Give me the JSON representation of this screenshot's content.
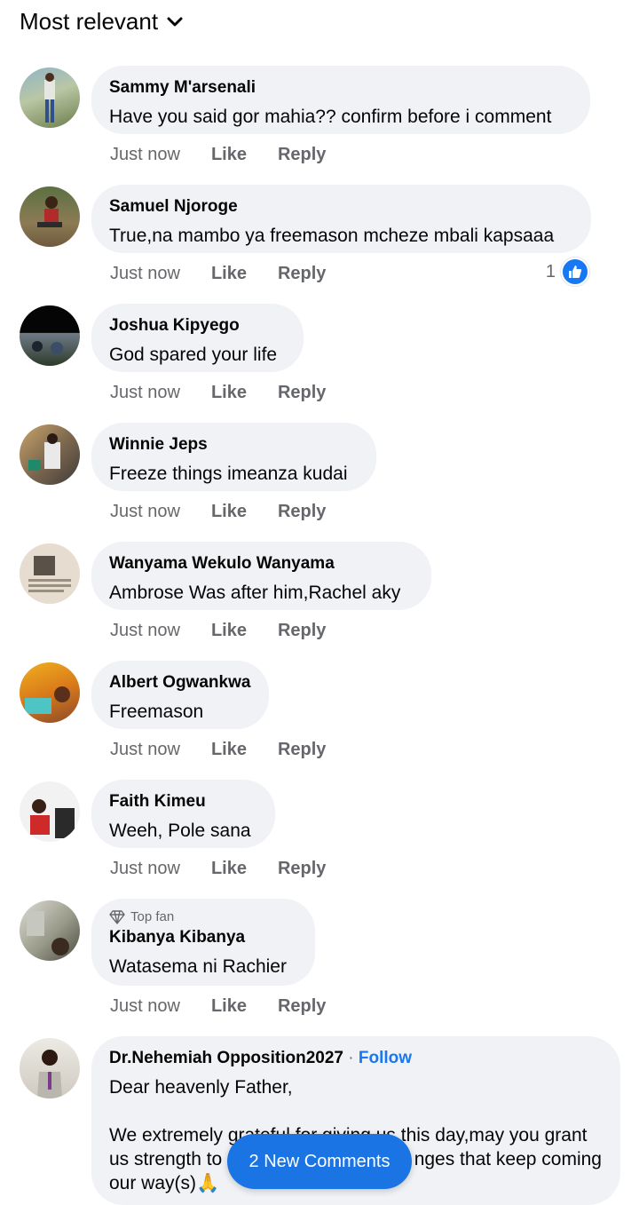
{
  "sort": {
    "label": "Most relevant"
  },
  "actions": {
    "time": "Just now",
    "like": "Like",
    "reply": "Reply"
  },
  "comments": [
    {
      "name": "Sammy M'arsenali",
      "text": "Have you said gor mahia?? confirm before i comment"
    },
    {
      "name": "Samuel Njoroge",
      "text": "True,na mambo ya freemason mcheze mbali kapsaaa",
      "reactions": "1"
    },
    {
      "name": "Joshua Kipyego",
      "text": "God spared your life"
    },
    {
      "name": "Winnie Jeps",
      "text": "Freeze things imeanza kudai"
    },
    {
      "name": "Wanyama Wekulo Wanyama",
      "text": "Ambrose Was after him,Rachel aky"
    },
    {
      "name": "Albert Ogwankwa",
      "text": "Freemason"
    },
    {
      "name": "Faith Kimeu",
      "text": "Weeh, Pole sana"
    },
    {
      "name": "Kibanya Kibanya",
      "badge": "Top fan",
      "text": "Watasema ni Rachier"
    },
    {
      "name": "Dr.Nehemiah Opposition2027",
      "separator": "·",
      "follow": "Follow",
      "line1": "Dear heavenly Father,",
      "line2": "We extremely grateful for giving us this day,may you grant",
      "line3a": "us strength to",
      "line3b": "nges that keep coming",
      "line4": "our way(s)🙏"
    }
  ],
  "new_comments": {
    "label": "2 New Comments"
  }
}
